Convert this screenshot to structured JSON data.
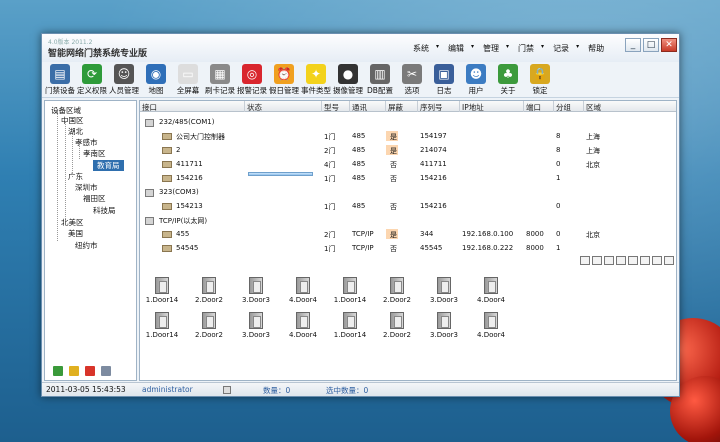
{
  "app": {
    "version": "4.0版本 2011.2",
    "title": "智能网络门禁系统专业版"
  },
  "menu": [
    "系统",
    "编辑",
    "管理",
    "门禁",
    "记录",
    "帮助"
  ],
  "window_buttons": [
    "_",
    "□",
    "✕"
  ],
  "toolbar": [
    {
      "label": "门禁设备",
      "icon": "door-device-icon",
      "color": "#3b6ea8"
    },
    {
      "label": "定义权限",
      "icon": "refresh-icon",
      "color": "#2e9b3a"
    },
    {
      "label": "人员管理",
      "icon": "people-icon",
      "color": "#555555"
    },
    {
      "label": "地图",
      "icon": "globe-icon",
      "color": "#2f6fb8"
    },
    {
      "label": "全屏幕",
      "icon": "fullscreen-icon",
      "color": "#dddddd"
    },
    {
      "label": "刷卡记录",
      "icon": "calculator-icon",
      "color": "#8a8a8a"
    },
    {
      "label": "报警记录",
      "icon": "target-icon",
      "color": "#d9262e"
    },
    {
      "label": "假日管理",
      "icon": "alarm-clock-icon",
      "color": "#f0a020"
    },
    {
      "label": "事件类型",
      "icon": "bulb-icon",
      "color": "#f3d21c"
    },
    {
      "label": "摄像管理",
      "icon": "camera-icon",
      "color": "#333333"
    },
    {
      "label": "DB配置",
      "icon": "db-config-icon",
      "color": "#666666"
    },
    {
      "label": "选项",
      "icon": "tools-icon",
      "color": "#7a7a7a"
    },
    {
      "label": "日志",
      "icon": "calendar-icon",
      "color": "#3a5f9a"
    },
    {
      "label": "用户",
      "icon": "users-icon",
      "color": "#3c7cc2"
    },
    {
      "label": "关于",
      "icon": "tree-icon",
      "color": "#3c9a3c"
    },
    {
      "label": "锁定",
      "icon": "lock-icon",
      "color": "#d8a820"
    }
  ],
  "tree": [
    {
      "label": "设备区域"
    },
    {
      "label": "中国区"
    },
    {
      "label": "湖北"
    },
    {
      "label": "孝感市"
    },
    {
      "label": "孝南区"
    },
    {
      "label": "教育局"
    },
    {
      "label": "广东"
    },
    {
      "label": "深圳市"
    },
    {
      "label": "福田区"
    },
    {
      "label": "科技局"
    },
    {
      "label": "北美区"
    },
    {
      "label": "美国"
    },
    {
      "label": "纽约市"
    }
  ],
  "table": {
    "headers": [
      "接口",
      "状态",
      "型号",
      "通讯",
      "屏蔽",
      "序列号",
      "IP地址",
      "端口",
      "分组",
      "区域"
    ],
    "rows": [
      {
        "name": "232/485(COM1)",
        "type": "port"
      },
      {
        "name": "公司大门控制器",
        "model": "1门",
        "comm": "485",
        "mask": "是",
        "serial": "154197",
        "group": "8",
        "area": "上海"
      },
      {
        "name": "2",
        "model": "2门",
        "comm": "485",
        "mask": "是",
        "serial": "214074",
        "group": "8",
        "area": "上海"
      },
      {
        "name": "411711",
        "model": "4门",
        "comm": "485",
        "mask": "否",
        "serial": "411711",
        "group": "0",
        "area": "北京"
      },
      {
        "name": "154216",
        "model": "1门",
        "comm": "485",
        "mask": "否",
        "serial": "154216",
        "group": "1",
        "area": ""
      },
      {
        "name": "323(COM3)",
        "type": "port"
      },
      {
        "name": "154213",
        "model": "1门",
        "comm": "485",
        "mask": "否",
        "serial": "154216",
        "group": "0",
        "area": ""
      },
      {
        "name": "TCP/IP(以太网)",
        "type": "port"
      },
      {
        "name": "455",
        "model": "2门",
        "comm": "TCP/IP",
        "mask": "是",
        "serial": "344",
        "ip": "192.168.0.100",
        "port": "8000",
        "group": "0",
        "area": "北京"
      },
      {
        "name": "54545",
        "model": "1门",
        "comm": "TCP/IP",
        "mask": "否",
        "serial": "45545",
        "ip": "192.168.0.222",
        "port": "8000",
        "group": "1",
        "area": ""
      }
    ]
  },
  "doors": [
    "1.Door14",
    "2.Door2",
    "3.Door3",
    "4.Door4",
    "1.Door14",
    "2.Door2",
    "3.Door3",
    "4.Door4",
    "1.Door14",
    "2.Door2",
    "3.Door3",
    "4.Door4",
    "1.Door14",
    "2.Door2",
    "3.Door3",
    "4.Door4"
  ],
  "statusbar": {
    "datetime": "2011-03-05 15:43:53",
    "user": "administrator",
    "count_label": "数量：0",
    "selected_label": "选中数量：0"
  }
}
